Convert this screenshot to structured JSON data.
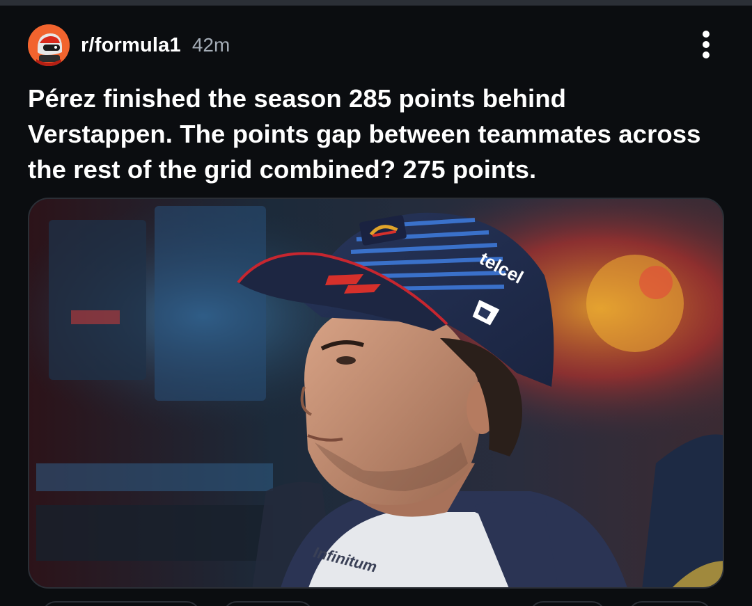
{
  "post": {
    "subreddit": "r/formula1",
    "age": "42m",
    "title": "Pérez finished the season 285 points behind Verstappen. The points gap between teammates across the rest of the grid combined? 275 points."
  },
  "image_text": {
    "cap_brand": "telcel",
    "shirt_sponsor": "Infinitum"
  },
  "icons": {
    "avatar": "subreddit-avatar-icon",
    "more": "more-vertical-icon"
  },
  "colors": {
    "background": "#0b0d10",
    "text_primary": "#ffffff",
    "text_secondary": "#a4acb6",
    "avatar_bg": "#f2642e",
    "border": "#2b2f36"
  }
}
